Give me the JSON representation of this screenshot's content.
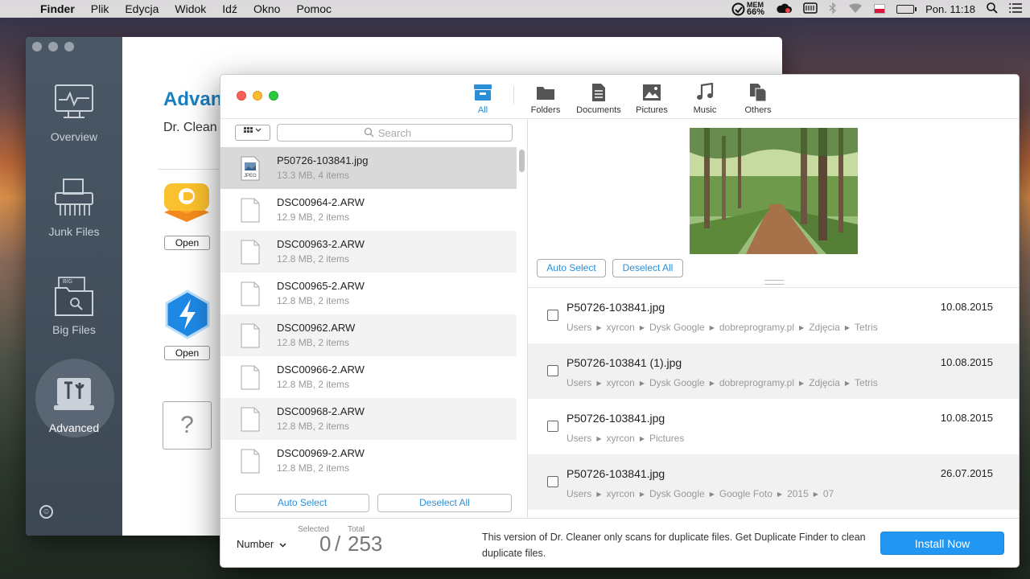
{
  "menubar": {
    "app": "Finder",
    "items": [
      "Plik",
      "Edycja",
      "Widok",
      "Idź",
      "Okno",
      "Pomoc"
    ],
    "mem_label": "MEM",
    "mem_value": "66%",
    "clock": "Pon. 11:18"
  },
  "back_window": {
    "sidebar": [
      {
        "label": "Overview",
        "icon": "monitor-icon"
      },
      {
        "label": "Junk Files",
        "icon": "shredder-icon"
      },
      {
        "label": "Big Files",
        "icon": "big-files-icon"
      },
      {
        "label": "Advanced",
        "icon": "tools-icon"
      }
    ],
    "big_files_badge": "BIG",
    "title": "Advan",
    "subtitle": "Dr. Clean",
    "open_label": "Open",
    "question": "?"
  },
  "toolbar": {
    "categories": [
      {
        "label": "All",
        "icon": "archive-box-icon"
      },
      {
        "label": "Folders",
        "icon": "folder-icon"
      },
      {
        "label": "Documents",
        "icon": "document-icon"
      },
      {
        "label": "Pictures",
        "icon": "picture-icon"
      },
      {
        "label": "Music",
        "icon": "music-note-icon"
      },
      {
        "label": "Others",
        "icon": "others-icon"
      }
    ]
  },
  "left": {
    "search_placeholder": "Search",
    "files": [
      {
        "name": "P50726-103841.jpg",
        "meta": "13.3 MB, 4 items",
        "type": "jpeg"
      },
      {
        "name": "DSC00964-2.ARW",
        "meta": "12.9 MB, 2 items",
        "type": "file"
      },
      {
        "name": "DSC00963-2.ARW",
        "meta": "12.8 MB, 2 items",
        "type": "file"
      },
      {
        "name": "DSC00965-2.ARW",
        "meta": "12.8 MB, 2 items",
        "type": "file"
      },
      {
        "name": "DSC00962.ARW",
        "meta": "12.8 MB, 2 items",
        "type": "file"
      },
      {
        "name": "DSC00966-2.ARW",
        "meta": "12.8 MB, 2 items",
        "type": "file"
      },
      {
        "name": "DSC00968-2.ARW",
        "meta": "12.8 MB, 2 items",
        "type": "file"
      },
      {
        "name": "DSC00969-2.ARW",
        "meta": "12.8 MB, 2 items",
        "type": "file"
      }
    ],
    "jpeg_badge": "JPEG",
    "auto_select": "Auto Select",
    "deselect_all": "Deselect All"
  },
  "right": {
    "auto_select": "Auto Select",
    "deselect_all": "Deselect All",
    "duplicates": [
      {
        "name": "P50726-103841.jpg",
        "date": "10.08.2015",
        "path": [
          "Users",
          "xyrcon",
          "Dysk Google",
          "dobreprogramy.pl",
          "Zdjęcia",
          "Tetris"
        ]
      },
      {
        "name": "P50726-103841 (1).jpg",
        "date": "10.08.2015",
        "path": [
          "Users",
          "xyrcon",
          "Dysk Google",
          "dobreprogramy.pl",
          "Zdjęcia",
          "Tetris"
        ]
      },
      {
        "name": "P50726-103841.jpg",
        "date": "10.08.2015",
        "path": [
          "Users",
          "xyrcon",
          "Pictures"
        ]
      },
      {
        "name": "P50726-103841.jpg",
        "date": "26.07.2015",
        "path": [
          "Users",
          "xyrcon",
          "Dysk Google",
          "Google Foto",
          "2015",
          "07"
        ]
      }
    ]
  },
  "bottom": {
    "sort_label": "Number",
    "selected_label": "Selected",
    "total_label": "Total",
    "selected": "0",
    "separator": "/",
    "total": "253",
    "notice": "This version of Dr. Cleaner only scans for duplicate files. Get Duplicate Finder to clean duplicate files.",
    "install": "Install Now"
  },
  "colors": {
    "accent": "#2a8fd8",
    "install_bg": "#2196f3",
    "back_title": "#1a7fc1",
    "sidebar_bg": "#3f4a56"
  }
}
